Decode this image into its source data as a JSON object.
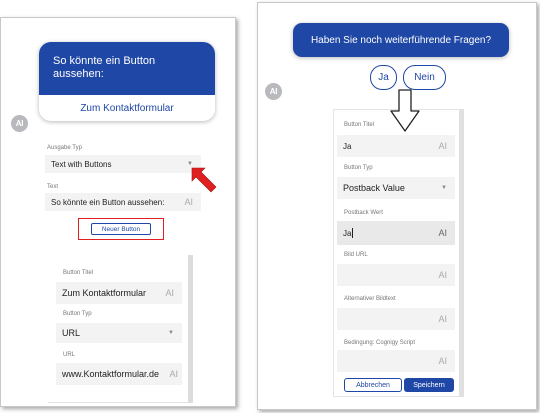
{
  "left": {
    "bubble_text": "So könnte ein Button aussehen:",
    "bubble_button": "Zum Kontaktformular",
    "avatar": "AI",
    "output_type_label": "Ausgabe Typ",
    "output_type_value": "Text with Buttons",
    "text_label": "Text",
    "text_value": "So könnte ein Button aussehen:",
    "new_button": "Neuer Button",
    "editor": {
      "title_label": "Button Titel",
      "title_value": "Zum Kontaktformular",
      "type_label": "Button Typ",
      "type_value": "URL",
      "url_label": "URL",
      "url_value": "www.Kontaktformular.de"
    }
  },
  "right": {
    "bubble_text": "Haben Sie noch weiterführende Fragen?",
    "avatar": "AI",
    "quick_replies": [
      "Ja",
      "Nein"
    ],
    "form": {
      "title_label": "Button Titel",
      "title_value": "Ja",
      "type_label": "Button Typ",
      "type_value": "Postback Value",
      "postback_label": "Postback Wert",
      "postback_value": "Ja",
      "image_url_label": "Bild URL",
      "alt_text_label": "Alternativer Bildtext",
      "condition_label": "Bedingung: Cognigy Script",
      "cancel": "Abbrechen",
      "save": "Speichern"
    }
  },
  "ai_token": "AI",
  "colors": {
    "brand_blue": "#1f47a6",
    "highlight_red": "#e02020"
  },
  "icons": [
    "dropdown-caret-icon",
    "red-arrow-icon",
    "down-arrow-icon",
    "ai-token-icon"
  ]
}
